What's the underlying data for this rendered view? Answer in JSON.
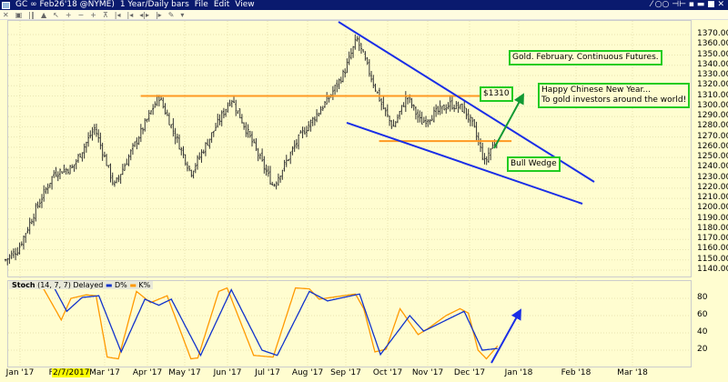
{
  "window": {
    "title": "GC ∞ Feb26'18 @NYME)",
    "interval": "1 Year/Daily bars",
    "menus": [
      "File",
      "Edit",
      "View"
    ],
    "controls": "⁄ ○○ ⊣⊢ ▪ ▬ ■ ✕"
  },
  "toolbar_icons": [
    "close-icon",
    "text-icon",
    "bar-chart-icon",
    "mountain-icon",
    "cursor-icon",
    "zoom-in-icon",
    "zoom-out-icon",
    "crosshair-icon",
    "volume-icon",
    "scroll-left-icon",
    "scroll-right-icon",
    "center-icon",
    "expand-icon",
    "draw-icon",
    "dropdown-icon"
  ],
  "annotations": {
    "title_note": "Gold. February. Continuous Futures.",
    "resistance": "$1310",
    "greeting_line1": "Happy Chinese New Year...",
    "greeting_line2": "To gold investors around the world!",
    "pattern": "Bull Wedge"
  },
  "stoch_legend": {
    "name": "Stoch",
    "params": "(14, 7, 7) Delayed",
    "d": "D%",
    "k": "K%"
  },
  "cursor_date": "2/7/2017",
  "colors": {
    "bars": "#333333",
    "k": "#ff9900",
    "d": "#1133cc",
    "trend": "#1a2ee6",
    "level": "#ff9922",
    "arrow_green": "#119933",
    "box": "#22cc22"
  },
  "chart_data": [
    {
      "type": "ohlc",
      "title": "GC Feb26'18 Daily",
      "yticks": [
        "1370.00",
        "1360.00",
        "1350.00",
        "1340.00",
        "1330.00",
        "1320.00",
        "1310.00",
        "1300.00",
        "1290.00",
        "1280.00",
        "1270.00",
        "1260.00",
        "1250.00",
        "1240.00",
        "1230.00",
        "1220.00",
        "1210.00",
        "1200.00",
        "1190.00",
        "1180.00",
        "1170.00",
        "1160.00",
        "1150.00",
        "1140.00"
      ],
      "ylim": [
        1140,
        1370
      ],
      "xticks": [
        "Jan '17",
        "Feb '17",
        "Mar '17",
        "Apr '17",
        "May '17",
        "Jun '17",
        "Jul '17",
        "Aug '17",
        "Sep '17",
        "Oct '17",
        "Nov '17",
        "Dec '17",
        "Jan '18",
        "Feb '18",
        "Mar '18"
      ],
      "close_path": [
        [
          "2017-01-03",
          1150
        ],
        [
          "2017-01-12",
          1160
        ],
        [
          "2017-01-25",
          1200
        ],
        [
          "2017-02-07",
          1235
        ],
        [
          "2017-02-20",
          1240
        ],
        [
          "2017-03-08",
          1279
        ],
        [
          "2017-03-22",
          1222
        ],
        [
          "2017-04-23",
          1310
        ],
        [
          "2017-05-16",
          1235
        ],
        [
          "2017-06-14",
          1308
        ],
        [
          "2017-07-14",
          1222
        ],
        [
          "2017-08-02",
          1270
        ],
        [
          "2017-08-22",
          1306
        ],
        [
          "2017-09-03",
          1333
        ],
        [
          "2017-09-12",
          1366
        ],
        [
          "2017-09-20",
          1337
        ],
        [
          "2017-09-30",
          1301
        ],
        [
          "2017-10-08",
          1279
        ],
        [
          "2017-10-18",
          1310
        ],
        [
          "2017-10-28",
          1284
        ],
        [
          "2017-11-07",
          1293
        ],
        [
          "2017-11-18",
          1302
        ],
        [
          "2017-11-28",
          1297
        ],
        [
          "2017-12-05",
          1279
        ],
        [
          "2017-12-13",
          1244
        ],
        [
          "2017-12-16",
          1256
        ],
        [
          "2017-12-22",
          1269
        ]
      ],
      "levels": [
        {
          "price": 1310,
          "from": "2017-04-10",
          "to": "2017-12-10"
        },
        {
          "price": 1266,
          "from": "2017-09-28",
          "to": "2018-01-01"
        }
      ]
    },
    {
      "type": "line",
      "title": "Stoch (14, 7, 7)",
      "yticks": [
        "80",
        "60",
        "40",
        "20"
      ],
      "ylim": [
        0,
        100
      ],
      "series": [
        {
          "name": "K%",
          "points": [
            [
              "2017-01-30",
              92
            ],
            [
              "2017-02-12",
              55
            ],
            [
              "2017-02-19",
              80
            ],
            [
              "2017-03-02",
              84
            ],
            [
              "2017-03-09",
              83
            ],
            [
              "2017-03-17",
              12
            ],
            [
              "2017-03-25",
              10
            ],
            [
              "2017-04-07",
              88
            ],
            [
              "2017-04-17",
              75
            ],
            [
              "2017-04-29",
              83
            ],
            [
              "2017-05-16",
              10
            ],
            [
              "2017-05-21",
              11
            ],
            [
              "2017-06-05",
              88
            ],
            [
              "2017-06-11",
              92
            ],
            [
              "2017-06-30",
              14
            ],
            [
              "2017-07-14",
              12
            ],
            [
              "2017-07-30",
              92
            ],
            [
              "2017-08-09",
              91
            ],
            [
              "2017-08-16",
              79
            ],
            [
              "2017-09-11",
              85
            ],
            [
              "2017-09-17",
              68
            ],
            [
              "2017-09-25",
              18
            ],
            [
              "2017-10-03",
              21
            ],
            [
              "2017-10-13",
              68
            ],
            [
              "2017-10-26",
              38
            ],
            [
              "2017-11-02",
              45
            ],
            [
              "2017-11-15",
              60
            ],
            [
              "2017-11-25",
              68
            ],
            [
              "2017-12-01",
              63
            ],
            [
              "2017-12-08",
              20
            ],
            [
              "2017-12-14",
              10
            ],
            [
              "2017-12-22",
              25
            ]
          ]
        },
        {
          "name": "D%",
          "points": [
            [
              "2017-02-07",
              92
            ],
            [
              "2017-02-16",
              65
            ],
            [
              "2017-02-27",
              81
            ],
            [
              "2017-03-11",
              83
            ],
            [
              "2017-03-27",
              18
            ],
            [
              "2017-04-13",
              79
            ],
            [
              "2017-04-23",
              72
            ],
            [
              "2017-05-02",
              79
            ],
            [
              "2017-05-23",
              14
            ],
            [
              "2017-06-14",
              90
            ],
            [
              "2017-07-06",
              20
            ],
            [
              "2017-07-17",
              14
            ],
            [
              "2017-08-09",
              88
            ],
            [
              "2017-08-22",
              77
            ],
            [
              "2017-09-14",
              85
            ],
            [
              "2017-09-29",
              15
            ],
            [
              "2017-10-20",
              60
            ],
            [
              "2017-10-30",
              42
            ],
            [
              "2017-11-28",
              65
            ],
            [
              "2017-12-11",
              20
            ],
            [
              "2017-12-22",
              22
            ]
          ]
        }
      ]
    }
  ]
}
